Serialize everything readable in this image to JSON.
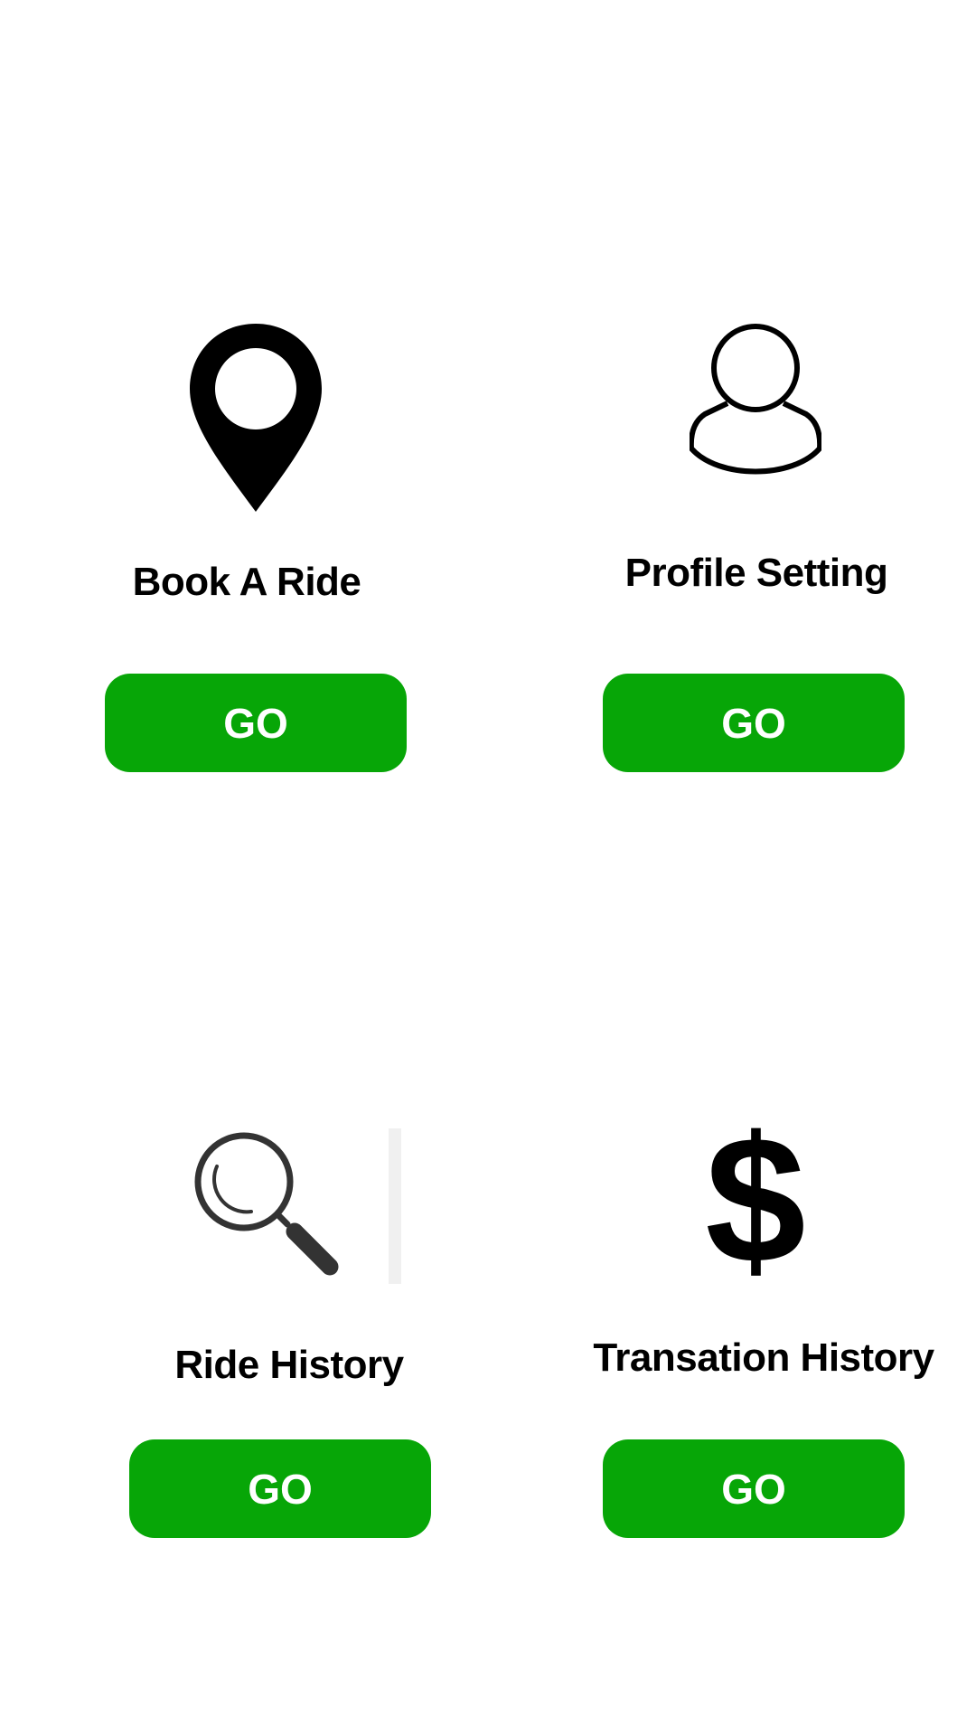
{
  "colors": {
    "background": "#ffffff",
    "button": "#07a607",
    "button_text": "#ffffff",
    "label_text": "#000000"
  },
  "tiles": [
    {
      "icon": "map-pin-icon",
      "label": "Book A Ride",
      "button": "GO"
    },
    {
      "icon": "user-profile-icon",
      "label": "Profile Setting",
      "button": "GO"
    },
    {
      "icon": "magnifier-icon",
      "label": "Ride History",
      "button": "GO"
    },
    {
      "icon": "dollar-icon",
      "label": "Transation History",
      "button": "GO"
    }
  ]
}
